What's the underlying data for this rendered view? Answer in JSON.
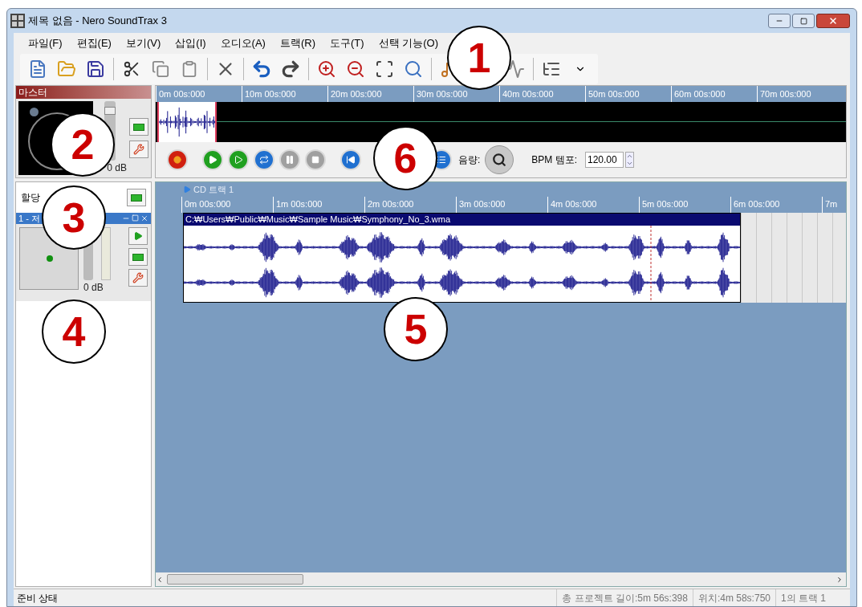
{
  "window": {
    "title": "제목 없음 - Nero SoundTrax 3"
  },
  "menu": [
    "파일(F)",
    "편집(E)",
    "보기(V)",
    "삽입(I)",
    "오디오(A)",
    "트랙(R)",
    "도구(T)",
    "선택 기능(O)"
  ],
  "master": {
    "title": "마스터",
    "gain": "0 dB",
    "volume": {
      "level": 0.9
    }
  },
  "overview": {
    "ruler": [
      "0m 00s:000",
      "10m 00s:000",
      "20m 00s:000",
      "30m 00s:000",
      "40m 00s:000",
      "50m 00s:000",
      "60m 00s:000",
      "70m 00s:000"
    ]
  },
  "transport": {
    "volume_label": "음량:",
    "bpm_label": "BPM 템포:",
    "bpm_value": "120.00"
  },
  "assign": {
    "label": "할당"
  },
  "track_strip": {
    "title": "1 - 저",
    "gain": "0 dB",
    "volume": {
      "level": 0.85
    }
  },
  "timeline": {
    "marker": "CD 트랙 1",
    "ruler": [
      "0m 00s:000",
      "1m 00s:000",
      "2m 00s:000",
      "3m 00s:000",
      "4m 00s:000",
      "5m 00s:000",
      "6m 00s:000",
      "7m"
    ],
    "clip": {
      "path": "C:₩Users₩Public₩Music₩Sample Music₩Symphony_No_3.wma"
    }
  },
  "status_bar": {
    "message": "준비 상태",
    "fields": [
      "총 프로젝트 길이:5m 56s:398",
      "위치:4m 58s:750",
      "1의 트랙 1"
    ]
  },
  "callouts": [
    "1",
    "2",
    "3",
    "4",
    "5",
    "6"
  ]
}
